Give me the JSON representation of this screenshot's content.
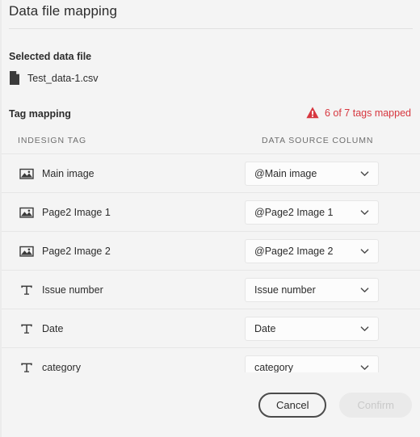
{
  "dialog": {
    "title": "Data file mapping"
  },
  "selected_file": {
    "label": "Selected data file",
    "icon": "file-icon",
    "name": "Test_data-1.csv"
  },
  "tag_mapping": {
    "label": "Tag mapping",
    "status": {
      "icon": "warning-triangle-icon",
      "text": "6 of 7 tags mapped",
      "color": "#d7373f"
    },
    "columns": {
      "tag": "INDESIGN TAG",
      "source": "DATA SOURCE COLUMN"
    },
    "rows": [
      {
        "icon": "image-icon",
        "tag": "Main image",
        "source": "@Main image"
      },
      {
        "icon": "image-icon",
        "tag": "Page2 Image 1",
        "source": "@Page2 Image 1"
      },
      {
        "icon": "image-icon",
        "tag": "Page2 Image 2",
        "source": "@Page2 Image 2"
      },
      {
        "icon": "text-icon",
        "tag": "Issue number",
        "source": "Issue number"
      },
      {
        "icon": "text-icon",
        "tag": "Date",
        "source": "Date"
      },
      {
        "icon": "text-icon",
        "tag": "category",
        "source": "category"
      }
    ]
  },
  "footer": {
    "cancel_label": "Cancel",
    "confirm_label": "Confirm"
  }
}
